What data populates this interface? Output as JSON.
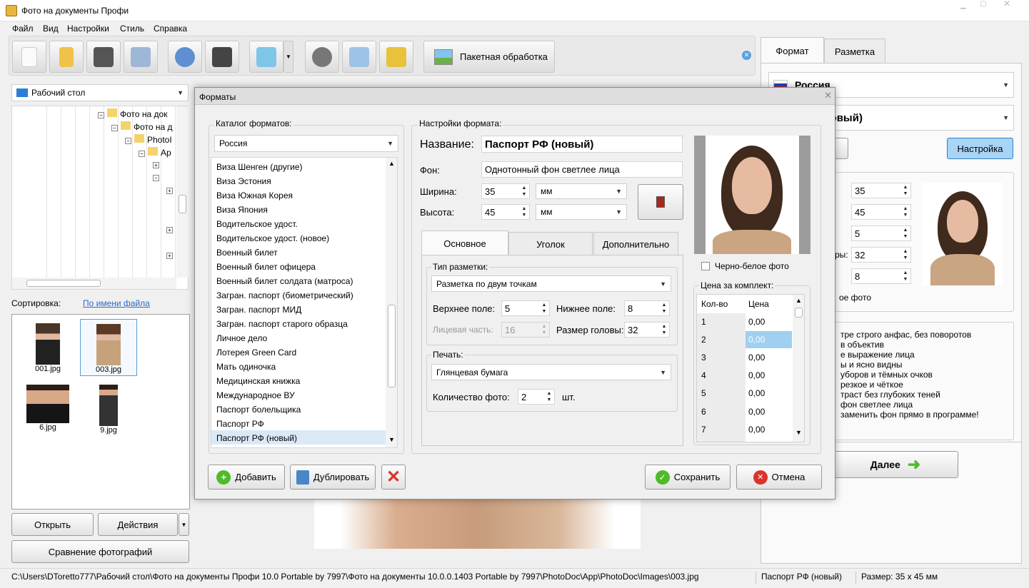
{
  "window": {
    "title": "Фото на документы Профи"
  },
  "menu": [
    "Файл",
    "Вид",
    "Настройки",
    "Стиль",
    "Справка"
  ],
  "toolbar": {
    "batch_label": "Пакетная обработка"
  },
  "left_panel": {
    "location": "Рабочий стол",
    "tree_items": [
      "Фото на док",
      "Фото на д",
      "PhotoI",
      "Ap"
    ],
    "sort_label": "Сортировка:",
    "sort_value": "По имени файла",
    "files": [
      "001.jpg",
      "003.jpg",
      "6.jpg",
      "9.jpg"
    ],
    "open_label": "Открыть",
    "actions_label": "Действия",
    "compare_label": "Сравнение фотографий"
  },
  "right_panel": {
    "tabs": [
      "Формат",
      "Разметка"
    ],
    "country": "Россия",
    "format": "порт РФ (новый)",
    "btn_partial": "е",
    "settings_label": "Настройка",
    "values": [
      "35",
      "45",
      "5",
      "32",
      "8"
    ],
    "partial_labels": [
      "ры:"
    ],
    "bw_partial": "ое фото",
    "tips": [
      "тре строго анфас, без поворотов",
      "в объектив",
      "е выражение лица",
      "ы и ясно видны",
      "уборов и тёмных очков",
      "резкое и чёткое",
      "траст без глубоких теней",
      "фон светлее лица",
      "заменить фон прямо в программе!"
    ],
    "next_label": "Далее"
  },
  "dialog": {
    "title": "Форматы",
    "catalog_label": "Каталог форматов:",
    "catalog_country": "Россия",
    "formats": [
      "Виза Шенген (другие)",
      "Виза Эстония",
      "Виза Южная Корея",
      "Виза Япония",
      "Водительское удост.",
      "Водительское удост. (новое)",
      "Военный билет",
      "Военный билет офицера",
      "Военный билет солдата (матроса)",
      "Загран. паспорт (биометрический)",
      "Загран. паспорт МИД",
      "Загран. паспорт старого образца",
      "Личное дело",
      "Лотерея Green Card",
      "Мать одиночка",
      "Медицинская книжка",
      "Международное ВУ",
      "Паспорт болельщика",
      "Паспорт РФ",
      "Паспорт РФ (новый)"
    ],
    "selected_format": "Паспорт РФ (новый)",
    "settings_label": "Настройки формата:",
    "name_label": "Название:",
    "name_value": "Паспорт РФ (новый)",
    "bg_label": "Фон:",
    "bg_value": "Однотонный фон светлее лица",
    "width_label": "Ширина:",
    "width_value": "35",
    "width_unit": "мм",
    "height_label": "Высота:",
    "height_value": "45",
    "height_unit": "мм",
    "tabs": [
      "Основное",
      "Уголок",
      "Дополнительно"
    ],
    "markup_group": "Тип разметки:",
    "markup_type": "Разметка по двум точкам",
    "top_margin_label": "Верхнее поле:",
    "top_margin": "5",
    "bottom_margin_label": "Нижнее поле:",
    "bottom_margin": "8",
    "face_label": "Лицевая часть:",
    "face_value": "16",
    "head_label": "Размер головы:",
    "head_value": "32",
    "print_group": "Печать:",
    "paper": "Глянцевая бумага",
    "count_label": "Количество фото:",
    "count_value": "2",
    "count_unit": "шт.",
    "bw_label": "Черно-белое фото",
    "price_label": "Цена за комплект:",
    "price_headers": [
      "Кол-во",
      "Цена"
    ],
    "price_rows": [
      [
        "1",
        "0,00"
      ],
      [
        "2",
        "0,00"
      ],
      [
        "3",
        "0,00"
      ],
      [
        "4",
        "0,00"
      ],
      [
        "5",
        "0,00"
      ],
      [
        "6",
        "0,00"
      ],
      [
        "7",
        "0,00"
      ]
    ],
    "add_label": "Добавить",
    "duplicate_label": "Дублировать",
    "save_label": "Сохранить",
    "cancel_label": "Отмена"
  },
  "status": {
    "path": "C:\\Users\\DToretto777\\Рабочий стол\\Фото на документы Профи 10.0 Portable by 7997\\Фото на документы 10.0.0.1403 Portable by 7997\\PhotoDoc\\App\\PhotoDoc\\Images\\003.jpg",
    "format": "Паспорт РФ (новый)",
    "size": "Размер: 35 x 45 мм"
  },
  "colors": {
    "accent": "#2a6ac8",
    "selection": "#9fd0ef",
    "settings_btn": "#a8d4f5"
  }
}
